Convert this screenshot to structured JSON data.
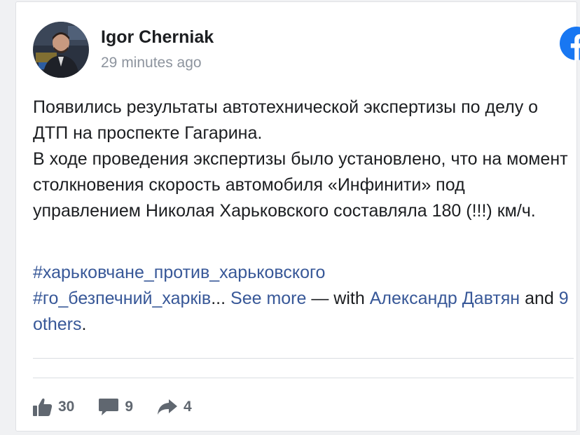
{
  "post": {
    "author": "Igor Cherniak",
    "timestamp": "29 minutes ago",
    "body_lines": [
      "Появились результаты автотехнической экспертизы по делу о ДТП на проспекте Гагарина.",
      "В ходе проведения экспертизы было установлено, что на момент столкновения скорость автомобиля «Инфинити» под управлением Николая Харьковского составляла 180 (!!!) км/ч."
    ],
    "hashtag_1": "#харьковчане_против_харьковского",
    "hashtag_2": "#го_безпечний_харків",
    "ellipsis": "...",
    "see_more": "See more",
    "with_prefix": " — with ",
    "tagged_person": "Александр Давтян",
    "and_text": " and ",
    "others_link": "9 others",
    "period": "."
  },
  "stats": {
    "likes": "30",
    "comments": "9",
    "shares": "4"
  },
  "colors": {
    "link": "#385898",
    "facebook_brand": "#1877f2",
    "muted": "#8d949e",
    "icon": "#606770"
  },
  "icons": {
    "brand": "facebook-logo-icon",
    "like": "thumbs-up-icon",
    "comment": "comment-icon",
    "share": "share-arrow-icon"
  }
}
